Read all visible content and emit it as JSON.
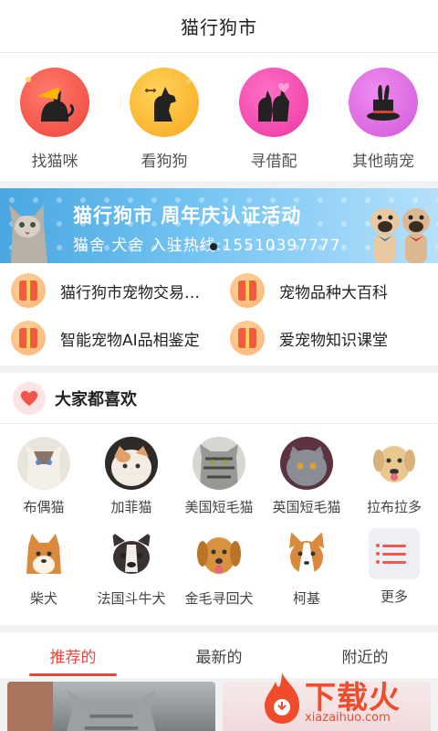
{
  "header": {
    "title": "猫行狗市"
  },
  "categories": [
    {
      "label": "找猫咪",
      "icon": "cat-icon",
      "color": "#f0453c"
    },
    {
      "label": "看狗狗",
      "icon": "dog-icon",
      "color": "#f8a81d"
    },
    {
      "label": "寻借配",
      "icon": "pets-pair-icon",
      "color": "#ec37a4"
    },
    {
      "label": "其他萌宠",
      "icon": "magic-hat-icon",
      "color": "#cf5bd9"
    }
  ],
  "banner": {
    "line1": "猫行狗市 周年庆认证活动",
    "line2": "猫舍 犬舍 入驻热线:15510397777"
  },
  "quick_links": [
    {
      "label": "猫行狗市宠物交易…"
    },
    {
      "label": "宠物品种大百科"
    },
    {
      "label": "智能宠物AI品相鉴定"
    },
    {
      "label": "爱宠物知识课堂"
    }
  ],
  "favorites": {
    "title": "大家都喜欢",
    "breeds": [
      {
        "name": "布偶猫",
        "icon": "ragdoll-cat-avatar"
      },
      {
        "name": "加菲猫",
        "icon": "exotic-cat-avatar"
      },
      {
        "name": "美国短毛猫",
        "icon": "american-shorthair-avatar"
      },
      {
        "name": "英国短毛猫",
        "icon": "british-shorthair-avatar"
      },
      {
        "name": "拉布拉多",
        "icon": "labrador-avatar"
      },
      {
        "name": "柴犬",
        "icon": "shiba-avatar"
      },
      {
        "name": "法国斗牛犬",
        "icon": "french-bulldog-avatar"
      },
      {
        "name": "金毛寻回犬",
        "icon": "golden-retriever-avatar"
      },
      {
        "name": "柯基",
        "icon": "corgi-avatar"
      },
      {
        "name": "更多",
        "icon": "more-list-icon"
      }
    ]
  },
  "tabs": [
    {
      "label": "推荐的",
      "active": true
    },
    {
      "label": "最新的",
      "active": false
    },
    {
      "label": "附近的",
      "active": false
    }
  ],
  "watermark": {
    "brand": "下载火",
    "url": "xiazaihuo.com"
  },
  "colors": {
    "accent": "#f0453c",
    "banner": "#4aa7e0"
  }
}
